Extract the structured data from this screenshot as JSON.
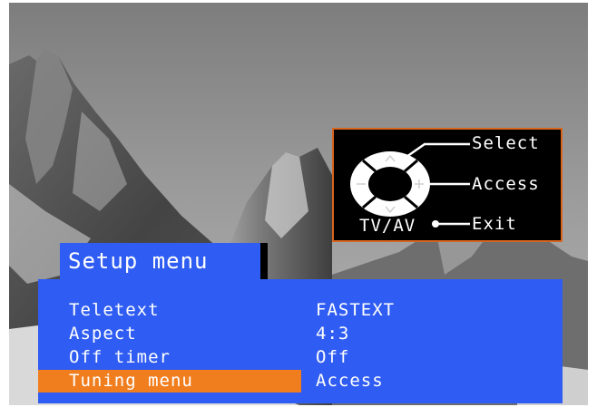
{
  "remote_help": {
    "select_label": "Select",
    "access_label": "Access",
    "exit_label": "Exit",
    "source_key_label": "TV/AV",
    "up_glyph": "^",
    "down_glyph": "v",
    "left_glyph": "−",
    "right_glyph": "+"
  },
  "setup_menu": {
    "title": "Setup menu",
    "items": [
      {
        "label": "Teletext",
        "value": "FASTEXT",
        "selected": false
      },
      {
        "label": "Aspect",
        "value": "4:3",
        "selected": false
      },
      {
        "label": "Off timer",
        "value": "Off",
        "selected": false
      },
      {
        "label": "Tuning menu",
        "value": "Access",
        "selected": true
      }
    ]
  },
  "colors": {
    "menu_blue": "#2f5cf2",
    "highlight_orange": "#f07e1f",
    "help_border": "#d7641e",
    "text": "#ffffff"
  }
}
